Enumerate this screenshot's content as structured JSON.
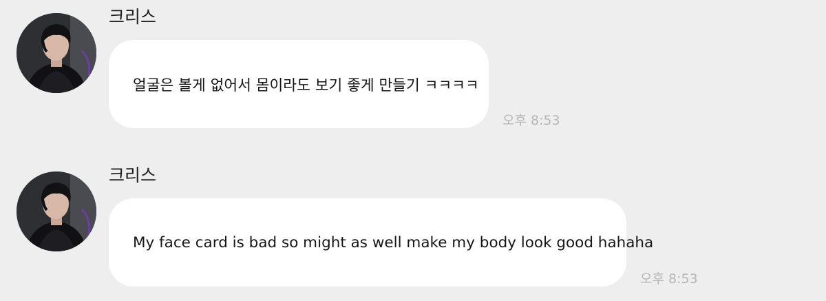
{
  "chat": {
    "messages": [
      {
        "sender": "크리스",
        "text": "얼굴은 볼게 없어서 몸이라도 보기 좋게 만들기 ㅋㅋㅋㅋ",
        "time": "오후 8:53",
        "avatar_icon": "profile-photo"
      },
      {
        "sender": "크리스",
        "text": "My face card is bad so might as well make my body look good hahaha",
        "time": "오후 8:53",
        "avatar_icon": "profile-photo"
      }
    ]
  }
}
